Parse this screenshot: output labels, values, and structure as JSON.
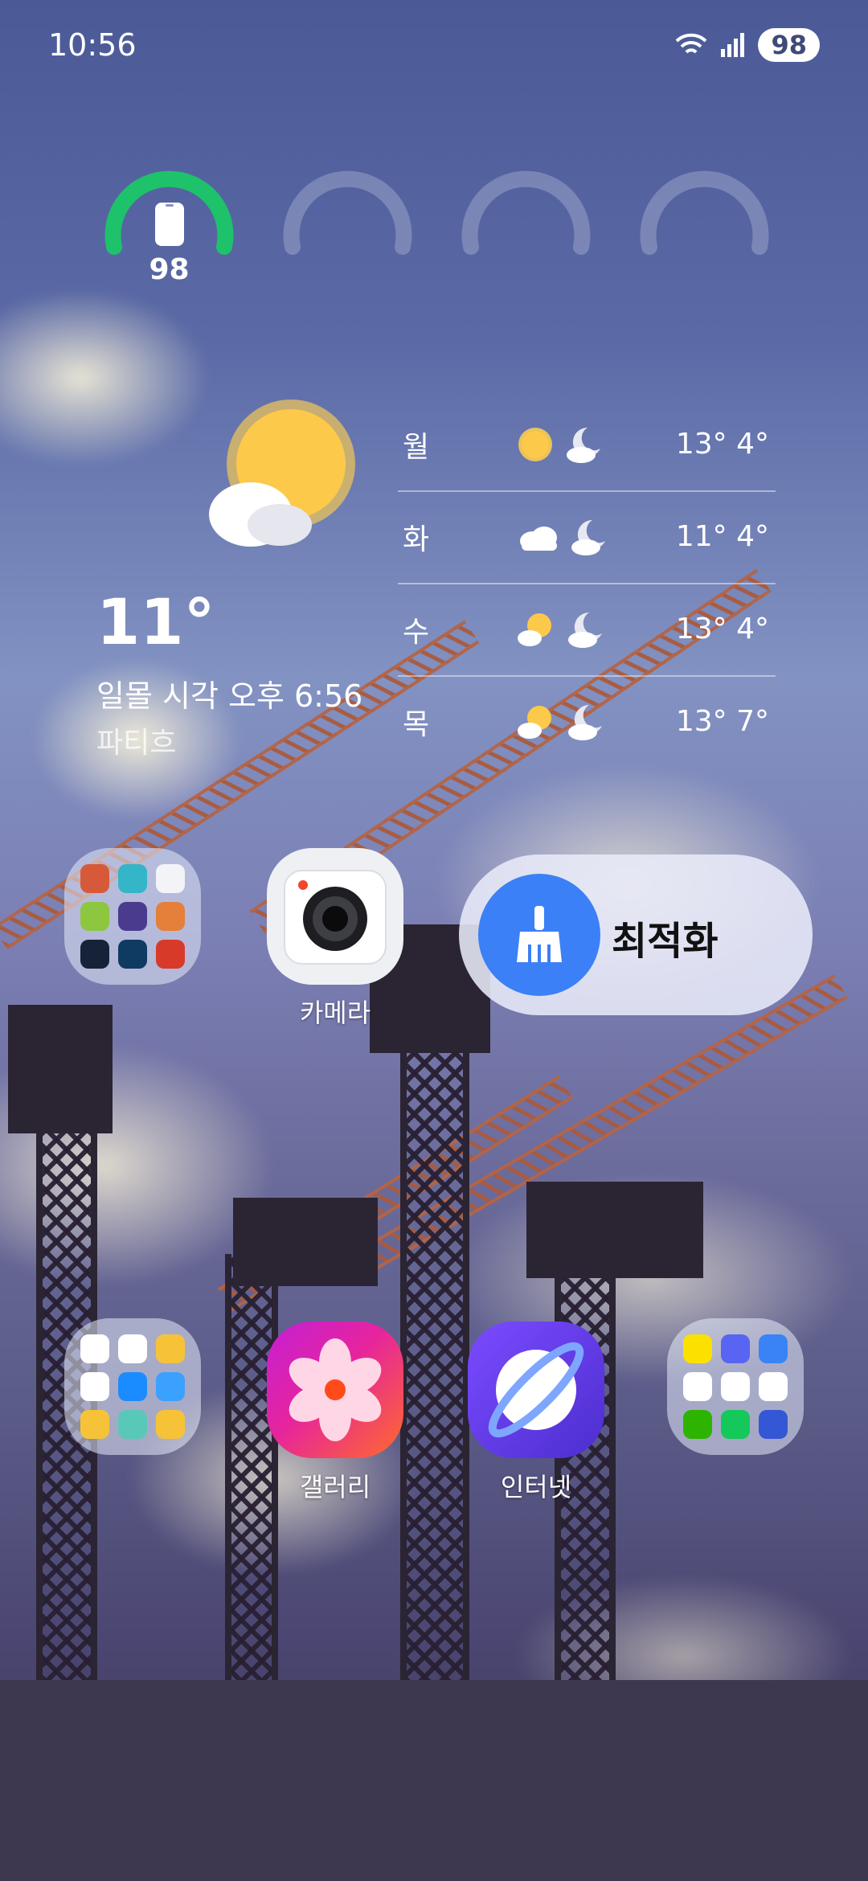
{
  "status_bar": {
    "time": "10:56",
    "battery": "98"
  },
  "battery_widget": {
    "phone_level_label": "98",
    "phone_level_fraction": 0.98
  },
  "weather": {
    "current_temp": "11°",
    "sunset": "일몰 시각 오후 6:56",
    "location": "파티흐",
    "forecast": [
      {
        "day": "월",
        "icons": [
          "sun-icon",
          "moon-cloud-icon"
        ],
        "temps": "13° 4°"
      },
      {
        "day": "화",
        "icons": [
          "cloud-icon",
          "moon-cloud-icon"
        ],
        "temps": "11° 4°"
      },
      {
        "day": "수",
        "icons": [
          "sun-cloud-icon",
          "moon-cloud-icon"
        ],
        "temps": "13° 4°"
      },
      {
        "day": "목",
        "icons": [
          "sun-cloud-icon",
          "moon-cloud-icon"
        ],
        "temps": "13° 7°"
      }
    ]
  },
  "apps": {
    "camera": "카메라",
    "optimize": "최적화",
    "gallery": "갤러리",
    "internet": "인터넷"
  },
  "colors": {
    "battery_green": "#1ec26a",
    "optimize_blue": "#3b80f6",
    "gallery_pink": "#e6249d",
    "internet_purple": "#5d35d8"
  }
}
